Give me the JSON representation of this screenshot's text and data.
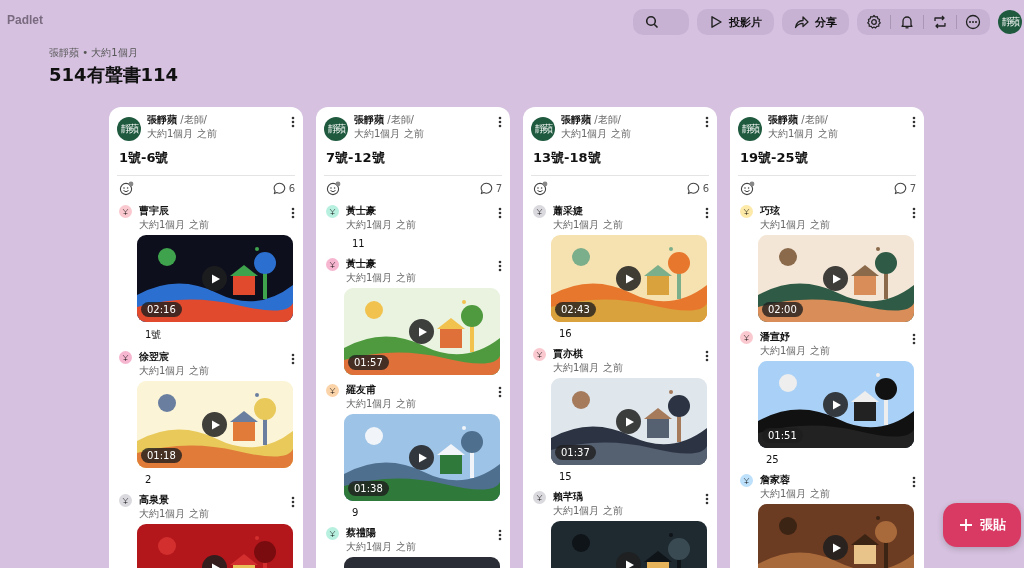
{
  "app": {
    "logo": "Padlet"
  },
  "toolbar": {
    "buttons": [
      {
        "label": "投影片",
        "kind": "slideshow"
      },
      {
        "label": "分享",
        "kind": "share"
      }
    ],
    "avatar": "靜蘋"
  },
  "board": {
    "meta": "張靜蘋 • 大約1個月",
    "title": "514有聲書114"
  },
  "columns": [
    {
      "author": "張靜蘋",
      "role": "/老師/",
      "time": "大約1個月 之前",
      "avatar": "靜蘋",
      "title": "1號-6號",
      "comments": "6",
      "posts": [
        {
          "author": "曹宇辰",
          "time": "大約1個月 之前",
          "color": "#f9c9cf",
          "video": {
            "kind": "picture",
            "duration": "02:16"
          },
          "caption": "1號"
        },
        {
          "author": "徐翌宸",
          "time": "大約1個月 之前",
          "color": "#f7b6d0",
          "video": {
            "kind": "picture",
            "duration": "01:18"
          },
          "caption": "2"
        },
        {
          "author": "高泉景",
          "time": "大約1個月 之前",
          "color": "#d9d9de"
        }
      ]
    },
    {
      "author": "張靜蘋",
      "role": "/老師/",
      "time": "大約1個月 之前",
      "avatar": "靜蘋",
      "title": "7號-12號",
      "comments": "7",
      "posts": [
        {
          "author": "黃士豪",
          "time": "大約1個月 之前",
          "color": "#b8f0e0",
          "caption": "11"
        },
        {
          "author": "黃士豪",
          "time": "大約1個月 之前",
          "color": "#f7b6d0",
          "video": {
            "kind": "picture",
            "duration": "01:57"
          }
        },
        {
          "author": "羅友甫",
          "time": "大約1個月 之前",
          "color": "#fbd3a8",
          "video": {
            "kind": "picture",
            "duration": "01:38"
          },
          "caption": "9"
        },
        {
          "author": "蔡禮陽",
          "time": "大約1個月 之前",
          "color": "#b8f0e0"
        }
      ]
    },
    {
      "author": "張靜蘋",
      "role": "/老師/",
      "time": "大約1個月 之前",
      "avatar": "靜蘋",
      "title": "13號-18號",
      "comments": "6",
      "posts": [
        {
          "author": "蕭采婕",
          "time": "大約1個月 之前",
          "color": "#d9d9de",
          "video": {
            "kind": "picture",
            "duration": "02:43"
          },
          "caption": "16"
        },
        {
          "author": "賈亦棋",
          "time": "大約1個月 之前",
          "color": "#f9c9cf",
          "video": {
            "kind": "picture",
            "duration": "01:37"
          },
          "caption": "15"
        },
        {
          "author": "賴芊瑀",
          "time": "大約1個月 之前",
          "color": "#d9d9de"
        }
      ]
    },
    {
      "author": "張靜蘋",
      "role": "/老師/",
      "time": "大約1個月 之前",
      "avatar": "靜蘋",
      "title": "19號-25號",
      "comments": "7",
      "posts": [
        {
          "author": "巧玹",
          "time": "大約1個月 之前",
          "color": "#fde9a8",
          "video": {
            "kind": "picture",
            "duration": "02:00"
          }
        },
        {
          "author": "潘宣妤",
          "time": "大約1個月 之前",
          "color": "#f9c9cf",
          "video": {
            "kind": "picture",
            "duration": "01:51"
          },
          "caption": "25"
        },
        {
          "author": "詹家蓉",
          "time": "大約1個月 之前",
          "color": "#bde0fb"
        }
      ]
    }
  ],
  "fab": {
    "label": "張貼"
  }
}
